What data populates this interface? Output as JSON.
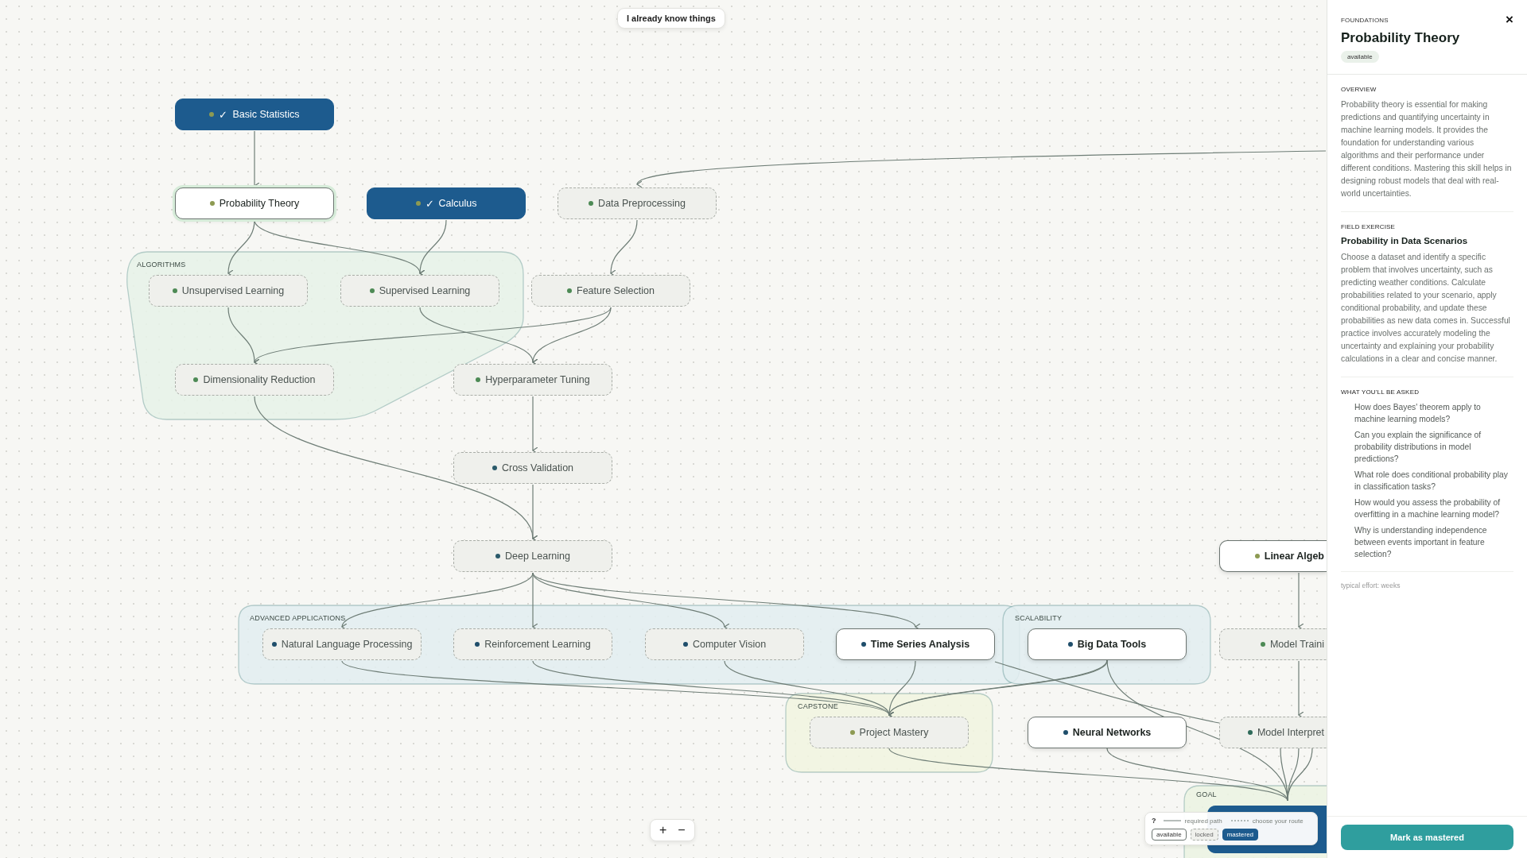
{
  "top_button": "I already know things",
  "groups": [
    {
      "label": "ALGORITHMS",
      "color": "#e6f2e8"
    },
    {
      "label": "ADVANCED APPLICATIONS",
      "color": "#e2edf0"
    },
    {
      "label": "SCALABILITY",
      "color": "#e2edf0"
    },
    {
      "label": "CAPSTONE",
      "color": "#f1f5df"
    },
    {
      "label": "GOAL",
      "color": "#ebf3e2"
    }
  ],
  "nodes": [
    {
      "label": "Basic Statistics",
      "kind": "mastered",
      "selected": false,
      "color": "#8d9a52",
      "mark": "✓"
    },
    {
      "label": "Probability Theory",
      "kind": "available",
      "selected": true,
      "color": "#8d9a52"
    },
    {
      "label": "Calculus",
      "kind": "mastered",
      "selected": false,
      "color": "#8d9a52",
      "mark": "✓"
    },
    {
      "label": "Data Preprocessing",
      "kind": "locked",
      "selected": false,
      "color": "#4d8a55"
    },
    {
      "label": "Unsupervised Learning",
      "kind": "locked",
      "selected": false,
      "color": "#4d8a55"
    },
    {
      "label": "Supervised Learning",
      "kind": "locked",
      "selected": false,
      "color": "#4d8a55"
    },
    {
      "label": "Feature Selection",
      "kind": "locked",
      "selected": false,
      "color": "#4d8a55"
    },
    {
      "label": "Dimensionality Reduction",
      "kind": "locked",
      "selected": false,
      "color": "#4d8a55"
    },
    {
      "label": "Hyperparameter Tuning",
      "kind": "locked",
      "selected": false,
      "color": "#4d8a55"
    },
    {
      "label": "Cross Validation",
      "kind": "locked",
      "selected": false,
      "color": "#2a5a6a"
    },
    {
      "label": "Deep Learning",
      "kind": "locked",
      "selected": false,
      "color": "#2a5a6a"
    },
    {
      "label": "Linear Algeb",
      "kind": "available",
      "selected": false,
      "color": "#8d9a52"
    },
    {
      "label": "Natural Language Processing",
      "kind": "locked",
      "selected": false,
      "color": "#1f4e6b"
    },
    {
      "label": "Reinforcement Learning",
      "kind": "locked",
      "selected": false,
      "color": "#1f4e6b"
    },
    {
      "label": "Computer Vision",
      "kind": "locked",
      "selected": false,
      "color": "#1f4e6b"
    },
    {
      "label": "Time Series Analysis",
      "kind": "available",
      "selected": false,
      "color": "#1f4e6b"
    },
    {
      "label": "Big Data Tools",
      "kind": "available",
      "selected": false,
      "color": "#1f4e6b"
    },
    {
      "label": "Model Traini",
      "kind": "locked",
      "selected": false,
      "color": "#4d8a55"
    },
    {
      "label": "Project Mastery",
      "kind": "locked",
      "selected": false,
      "color": "#8d9a52"
    },
    {
      "label": "Neural Networks",
      "kind": "available",
      "selected": false,
      "color": "#1f4e6b"
    },
    {
      "label": "Model Interpret",
      "kind": "locked",
      "selected": false,
      "color": "#2f6b5a"
    }
  ],
  "zoom_in": "+",
  "zoom_out": "−",
  "legend": {
    "help": "?",
    "required": "required path",
    "route": "choose your route",
    "chips": [
      {
        "label": "available",
        "kind": "available"
      },
      {
        "label": "locked",
        "kind": "locked"
      },
      {
        "label": "mastered",
        "kind": "mastered"
      }
    ]
  },
  "panel": {
    "category": "FOUNDATIONS",
    "close": "×",
    "title": "Probability Theory",
    "status": "available",
    "overview_heading": "OVERVIEW",
    "overview": "Probability theory is essential for making predictions and quantifying uncertainty in machine learning models. It provides the foundation for understanding various algorithms and their performance under different conditions. Mastering this skill helps in designing robust models that deal with real-world uncertainties.",
    "exercise_heading": "FIELD EXERCISE",
    "exercise_title": "Probability in Data Scenarios",
    "exercise": "Choose a dataset and identify a specific problem that involves uncertainty, such as predicting weather conditions. Calculate probabilities related to your scenario, apply conditional probability, and update these probabilities as new data comes in. Successful practice involves accurately modeling the uncertainty and explaining your probability calculations in a clear and concise manner.",
    "questions_heading": "WHAT YOU'LL BE ASKED",
    "questions": [
      "How does Bayes' theorem apply to machine learning models?",
      "Can you explain the significance of probability distributions in model predictions?",
      "What role does conditional probability play in classification tasks?",
      "How would you assess the probability of overfitting in a machine learning model?",
      "Why is understanding independence between events important in feature selection?"
    ],
    "effort": "typical effort: weeks",
    "action": "Mark as mastered"
  }
}
